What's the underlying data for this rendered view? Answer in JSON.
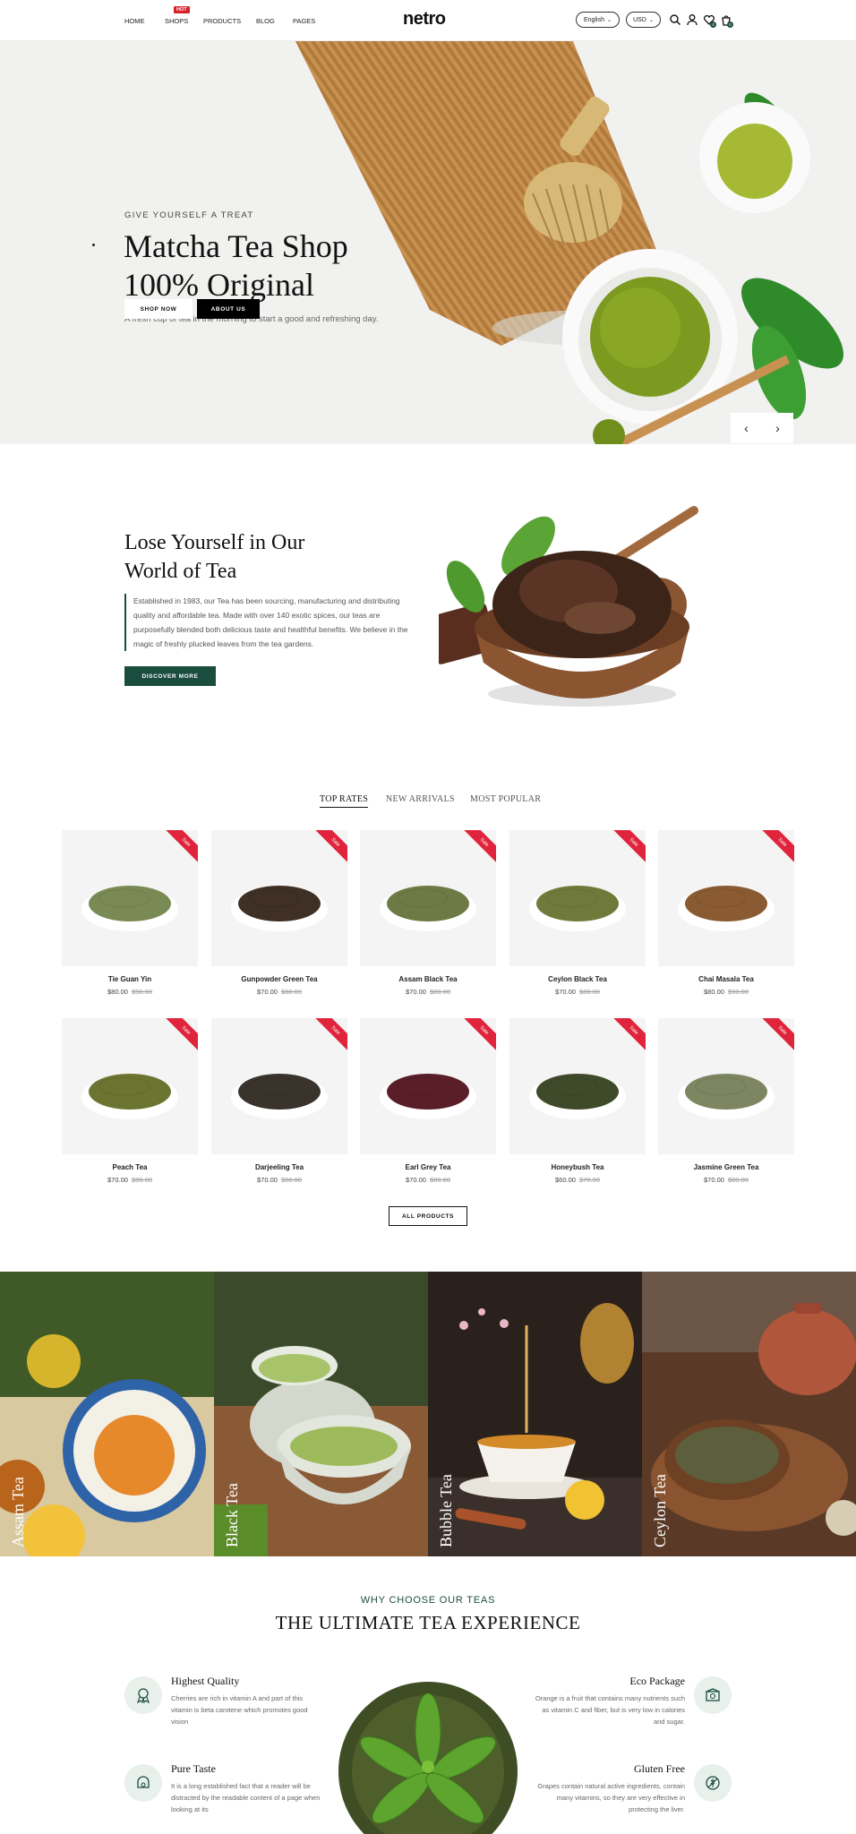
{
  "header": {
    "nav": [
      "HOME",
      "SHOPS",
      "PRODUCTS",
      "BLOG",
      "PAGES"
    ],
    "hot_badge": "HOT",
    "logo": "netro",
    "language": "English",
    "currency": "USD",
    "wishlist_count": "0",
    "cart_count": "0"
  },
  "hero": {
    "subtitle": "GIVE YOURSELF A TREAT",
    "title_line1": "Matcha Tea Shop",
    "title_line2": "100% Original",
    "description": "A fresh cup of tea in the morning to start a good and refreshing day.",
    "shop_now": "SHOP NOW",
    "about_us": "ABOUT US"
  },
  "about": {
    "title_line1": "Lose Yourself in Our",
    "title_line2": "World of Tea",
    "text": "Established in 1983, our Tea has been sourcing, manufacturing and distributing quality and affordable tea. Made with over 140 exotic spices, our teas are purposefully blended both delicious taste and healthful benefits. We believe in the magic of freshly plucked leaves from the tea gardens.",
    "button": "DISCOVER MORE"
  },
  "tabs": [
    "TOP RATES",
    "NEW ARRIVALS",
    "MOST POPULAR"
  ],
  "sale_label": "Sale",
  "products": [
    {
      "name": "Tie Guan Yin",
      "price": "$80.00",
      "old": "$90.00",
      "leaf": "#7a8a55"
    },
    {
      "name": "Gunpowder Green Tea",
      "price": "$70.00",
      "old": "$80.00",
      "leaf": "#3f2f24"
    },
    {
      "name": "Assam Black Tea",
      "price": "$70.00",
      "old": "$80.00",
      "leaf": "#6e7a45"
    },
    {
      "name": "Ceylon Black Tea",
      "price": "$70.00",
      "old": "$80.00",
      "leaf": "#6f7a3a"
    },
    {
      "name": "Chai Masala Tea",
      "price": "$80.00",
      "old": "$90.00",
      "leaf": "#8a5a32"
    },
    {
      "name": "Peach Tea",
      "price": "$70.00",
      "old": "$80.00",
      "leaf": "#6c7431"
    },
    {
      "name": "Darjeeling Tea",
      "price": "$70.00",
      "old": "$80.00",
      "leaf": "#3a332c"
    },
    {
      "name": "Earl Grey Tea",
      "price": "$70.00",
      "old": "$80.00",
      "leaf": "#5a1e28"
    },
    {
      "name": "Honeybush Tea",
      "price": "$60.00",
      "old": "$70.00",
      "leaf": "#3f4a2a"
    },
    {
      "name": "Jasmine Green Tea",
      "price": "$70.00",
      "old": "$80.00",
      "leaf": "#7d8660"
    }
  ],
  "all_products": "ALL PRODUCTS",
  "categories": [
    "Assam Tea",
    "Black Tea",
    "Bubble Tea",
    "Ceylon Tea"
  ],
  "why": {
    "subtitle": "WHY CHOOSE OUR TEAS",
    "title": "THE ULTIMATE TEA EXPERIENCE",
    "features": [
      {
        "title": "Highest Quality",
        "desc": "Cherries are rich in vitamin A and part of this vitamin is beta carotene which promotes good vision"
      },
      {
        "title": "Eco Package",
        "desc": "Orange is a fruit that contains many nutrients such as vitamin C and fiber, but is very low in calories and sugar."
      },
      {
        "title": "Pure Taste",
        "desc": "It is a long established fact that a reader will be distracted by the readable content of a page when looking at its"
      },
      {
        "title": "Gluten Free",
        "desc": "Grapes contain natural active ingredients, contain many vitamins, so they are very effective in protecting the liver."
      }
    ]
  },
  "colors": {
    "brand": "#1b4d3e",
    "sale": "#e0243b"
  }
}
